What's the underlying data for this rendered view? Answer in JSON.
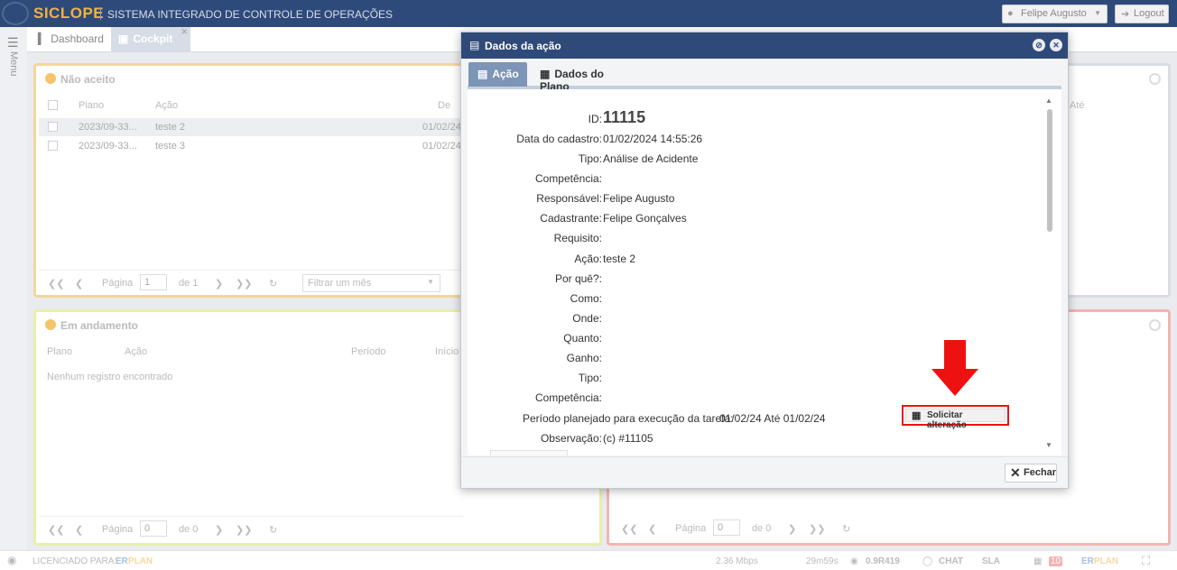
{
  "app": {
    "brand": "SICLOPE",
    "system_name": "SISTEMA INTEGRADO DE CONTROLE DE OPERAÇÕES",
    "user": "Felipe Augusto",
    "logout": "Logout",
    "menu": "Menu"
  },
  "tabs": [
    {
      "label": "Dashboard",
      "icon": "bar-chart-icon"
    },
    {
      "label": "Cockpit",
      "icon": "cockpit-icon"
    }
  ],
  "panels": {
    "nao_aceito": {
      "title": "Não aceito",
      "columns": [
        "Plano",
        "Ação",
        "De"
      ],
      "rows": [
        {
          "plano": "2023/09-33...",
          "acao": "teste 2",
          "de": "01/02/24"
        },
        {
          "plano": "2023/09-33...",
          "acao": "teste 3",
          "de": "01/02/24"
        }
      ],
      "pager": {
        "page_label": "Página",
        "page": "1",
        "of": "de 1",
        "filter_placeholder": "Filtrar um mês"
      }
    },
    "right_top": {
      "columns": [
        "Até"
      ]
    },
    "em_andamento": {
      "title": "Em andamento",
      "columns": [
        "Plano",
        "Ação",
        "Período",
        "Início"
      ],
      "empty": "Nenhum registro encontrado",
      "pager": {
        "page_label": "Página",
        "page": "0",
        "of": "de 0"
      }
    },
    "right_bottom": {
      "pager": {
        "page_label": "Página",
        "page": "0",
        "of": "de 0"
      }
    }
  },
  "status_bar": {
    "licensed": "LICENCIADO PARA:",
    "brand_a": "ER",
    "brand_b": "PLAN",
    "speed": "2.36 Mbps",
    "time": "29m59s",
    "version": "0.9R419",
    "chat": "CHAT",
    "sla": "SLA",
    "badge": "10"
  },
  "modal": {
    "title": "Dados da ação",
    "tabs": [
      "Ação",
      "Dados do Plano"
    ],
    "fields": [
      {
        "label": "ID:",
        "value": "11115"
      },
      {
        "label": "Data do cadastro:",
        "value": "01/02/2024 14:55:26"
      },
      {
        "label": "Tipo:",
        "value": "Análise de Acidente"
      },
      {
        "label": "Competência:",
        "value": ""
      },
      {
        "label": "Responsável:",
        "value": "Felipe Augusto"
      },
      {
        "label": "Cadastrante:",
        "value": "Felipe Gonçalves"
      },
      {
        "label": "Requisito:",
        "value": ""
      },
      {
        "label": "Ação:",
        "value": "teste 2"
      },
      {
        "label": "Por quê?:",
        "value": ""
      },
      {
        "label": "Como:",
        "value": ""
      },
      {
        "label": "Onde:",
        "value": ""
      },
      {
        "label": "Quanto:",
        "value": ""
      },
      {
        "label": "Ganho:",
        "value": ""
      },
      {
        "label": "Tipo:",
        "value": ""
      },
      {
        "label": "Competência:",
        "value": ""
      },
      {
        "label": "Período planejado para execução da tarefa:",
        "value": "01/02/24 Até 01/02/24"
      },
      {
        "label": "Observação:",
        "value": "(c) #11105"
      }
    ],
    "solicitar_label": "Solicitar alteração",
    "fechar_label": "Fechar"
  },
  "colors": {
    "header": "#2d4a7a",
    "brand": "#f0b33e",
    "modal_header": "#2f4a78",
    "active_tab": "#7d95b6",
    "highlight": "#ee1111"
  }
}
